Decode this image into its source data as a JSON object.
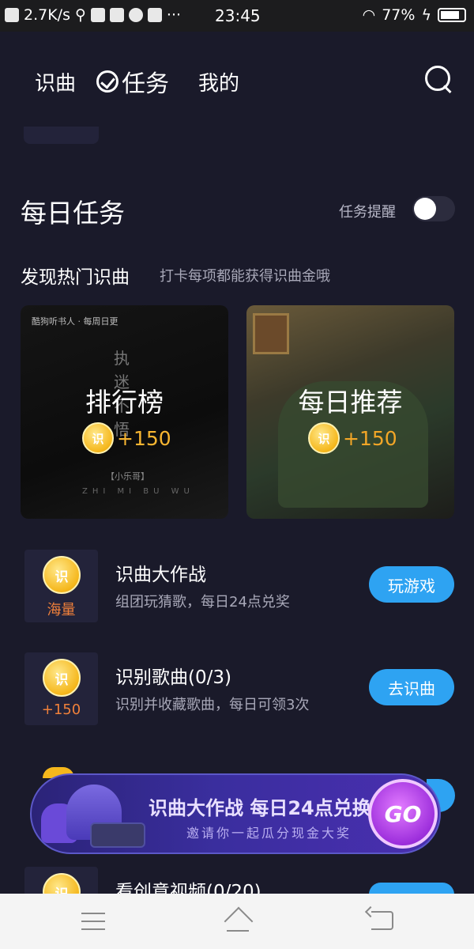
{
  "status_bar": {
    "net_speed": "2.7K/s",
    "dots": "···",
    "time": "23:45",
    "battery": "77%"
  },
  "header": {
    "tabs": [
      {
        "label": "识曲"
      },
      {
        "label": "任务"
      },
      {
        "label": "我的"
      }
    ]
  },
  "daily": {
    "title": "每日任务",
    "reminder_label": "任务提醒",
    "reminder_on": false
  },
  "discover": {
    "title": "发现热门识曲",
    "desc": "打卡每项都能获得识曲金哦",
    "cards": [
      {
        "title": "排行榜",
        "reward": "+150",
        "mini": "酷狗听书人 · 每周日更",
        "art_v": "执迷不悟",
        "art_h": "【小乐哥】",
        "art_h2": "ZHI MI BU WU"
      },
      {
        "title": "每日推荐",
        "reward": "+150"
      }
    ]
  },
  "tasks": [
    {
      "badge_text": "海量",
      "coin": "识",
      "name": "识曲大作战",
      "desc": "组团玩猜歌，每日24点兑奖",
      "button": "玩游戏"
    },
    {
      "badge_text": "+150",
      "coin": "识",
      "name": "识别歌曲(0/3)",
      "desc": "识别并收藏歌曲，每日可领3次",
      "button": "去识曲"
    },
    {
      "badge_text": "",
      "coin": "识",
      "name": "看创意视频(0/20)",
      "desc": "",
      "button": ""
    }
  ],
  "banner": {
    "line1": "识曲大作战 每日24点兑换",
    "line2": "邀请你一起瓜分现金大奖",
    "go": "GO"
  },
  "colors": {
    "accent": "#2ea3f2",
    "coin": "#f5b71c",
    "background": "#1a1a2a"
  }
}
